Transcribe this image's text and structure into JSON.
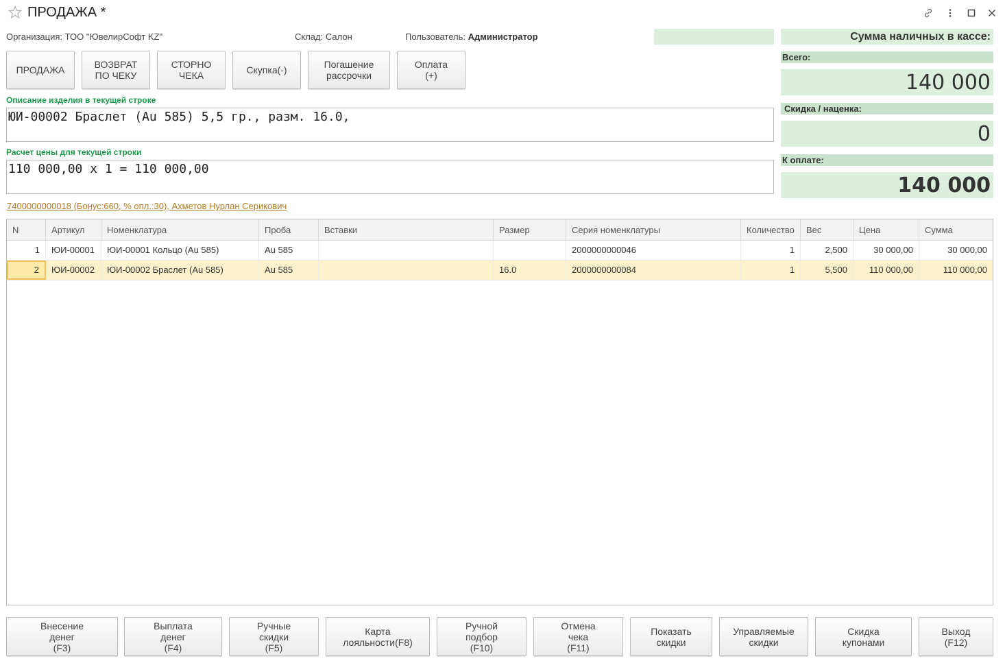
{
  "window": {
    "title": "ПРОДАЖА *"
  },
  "info": {
    "organization_label": "Организация:",
    "organization_value": "ТОО \"ЮвелирСофт KZ\"",
    "warehouse_label": "Склад:",
    "warehouse_value": "Салон",
    "user_label": "Пользователь:",
    "user_value": "Администратор"
  },
  "operations": [
    {
      "label": "ПРОДАЖА"
    },
    {
      "label": "ВОЗВРАТ\nПО ЧЕКУ"
    },
    {
      "label": "СТОРНО\nЧЕКА"
    },
    {
      "label": "Скупка(-)"
    },
    {
      "label": "Погашение\nрассрочки"
    },
    {
      "label": "Оплата\n(+)"
    }
  ],
  "description": {
    "label": "Описание изделия в текущей строке",
    "value": "ЮИ-00002 Браслет (Au 585) 5,5 гр., разм. 16.0,"
  },
  "price_calc": {
    "label": "Расчет цены для текущей строки",
    "value": "110 000,00 x 1 = 110 000,00"
  },
  "loyalty_link": "7400000000018 (Бонус:660, % опл.:30), Ахметов Нурлан Серикович",
  "totals": {
    "cash_title": "Сумма наличных в кассе:",
    "total_label": "Всего:",
    "total_value": "140 000",
    "discount_label": "Скидка / наценка:",
    "discount_value": "0",
    "to_pay_label": "К оплате:",
    "to_pay_value": "140 000"
  },
  "table": {
    "columns": [
      "N",
      "Артикул",
      "Номенклатура",
      "Проба",
      "Вставки",
      "Размер",
      "Серия номенклатуры",
      "Количество",
      "Вес",
      "Цена",
      "Сумма"
    ],
    "rows": [
      [
        "1",
        "ЮИ-00001",
        "ЮИ-00001 Кольцо (Au 585)",
        "Au 585",
        "",
        "",
        "2000000000046",
        "1",
        "2,500",
        "30 000,00",
        "30 000,00"
      ],
      [
        "2",
        "ЮИ-00002",
        "ЮИ-00002 Браслет (Au 585)",
        "Au 585",
        "",
        "16.0",
        "2000000000084",
        "1",
        "5,500",
        "110 000,00",
        "110 000,00"
      ]
    ],
    "selected_row": 1
  },
  "footer_buttons": [
    {
      "label": "Внесение\nденег\n(F3)"
    },
    {
      "label": "Выплата\nденег\n(F4)"
    },
    {
      "label": "Ручные\nскидки\n(F5)"
    },
    {
      "label": "Карта\nлояльности(F8)"
    },
    {
      "label": "Ручной\nподбор\n(F10)"
    },
    {
      "label": "Отмена\nчека\n(F11)"
    },
    {
      "label": "Показать\nскидки"
    },
    {
      "label": "Управляемые\nскидки"
    },
    {
      "label": "Скидка\nкупонами"
    },
    {
      "label": "Выход\n(F12)"
    }
  ],
  "colors": {
    "accent_green_label": "#1a9a4a",
    "totals_background": "#dcefdd",
    "selected_row": "#fcf1cb",
    "link": "#b07a1e"
  }
}
